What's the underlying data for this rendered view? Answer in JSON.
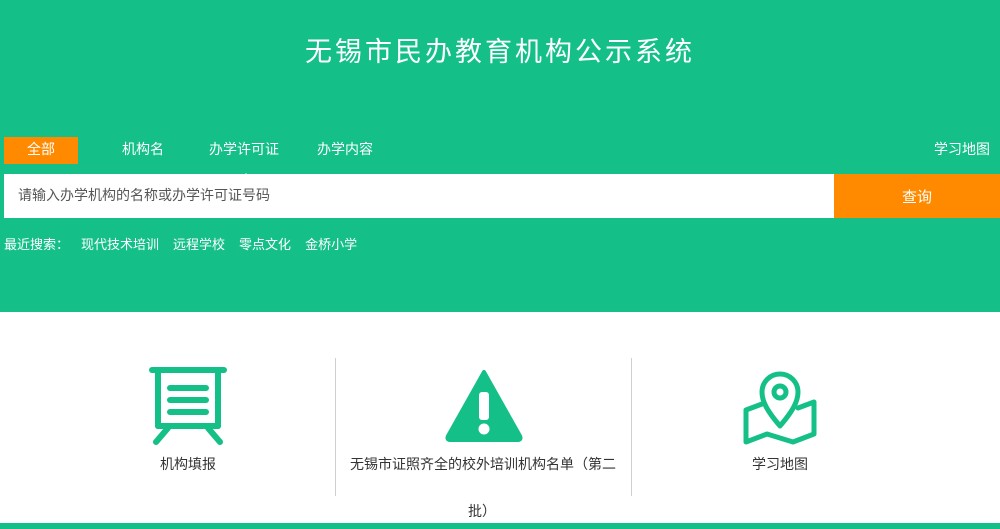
{
  "header": {
    "title": "无锡市民办教育机构公示系统"
  },
  "tabs": [
    {
      "label": "全部"
    },
    {
      "label": "机构名"
    },
    {
      "label": "办学许可证"
    },
    {
      "label": "办学内容"
    }
  ],
  "map_link": "学习地图",
  "search": {
    "placeholder": "请输入办学机构的名称或办学许可证号码",
    "button": "查询"
  },
  "recent": {
    "label": "最近搜索：",
    "items": [
      "现代技术培训",
      "远程学校",
      "零点文化",
      "金桥小学"
    ]
  },
  "cards": [
    {
      "label": "机构填报",
      "icon": "board-icon"
    },
    {
      "label": "无锡市证照齐全的校外培训机构名单（第二",
      "label_tail": "批）",
      "icon": "warning-icon"
    },
    {
      "label": "学习地图",
      "icon": "map-pin-icon"
    }
  ],
  "colors": {
    "brand": "#15c088",
    "accent": "#ff8a00"
  }
}
